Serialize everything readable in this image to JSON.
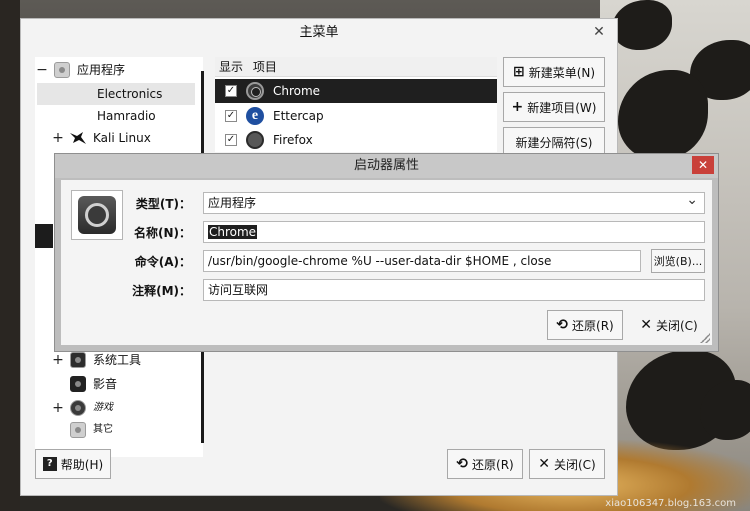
{
  "main_window": {
    "title": "主菜单",
    "close_label": "✕",
    "tree": [
      {
        "label": "应用程序",
        "expander": "−",
        "icon": "gear-icon"
      },
      {
        "label": "Electronics"
      },
      {
        "label": "Hamradio"
      },
      {
        "label": "Kali Linux",
        "expander": "+",
        "icon": "kali-dragon-icon"
      }
    ],
    "tree_bottom": [
      {
        "label": "系统工具",
        "expander": "+",
        "icon": "system-tools-icon"
      },
      {
        "label": "影音",
        "icon": "multimedia-icon"
      },
      {
        "label": "游戏",
        "expander": "+",
        "icon": "games-icon"
      },
      {
        "label": "其它",
        "icon": "gear-icon"
      }
    ],
    "list_headers": {
      "show": "显示",
      "item": "项目"
    },
    "items": [
      {
        "label": "Chrome",
        "checked": "✓",
        "icon": "chrome-icon"
      },
      {
        "label": "Ettercap",
        "checked": "✓",
        "icon": "ettercap-icon"
      },
      {
        "label": "Firefox",
        "checked": "✓",
        "icon": "firefox-icon"
      }
    ],
    "buttons": {
      "new_menu": "新建菜单(N)",
      "new_item": "新建项目(W)",
      "new_separator": "新建分隔符(S)",
      "help": "帮助(H)",
      "revert": "还原(R)",
      "close": "关闭(C)"
    }
  },
  "dialog": {
    "title": "启动器属性",
    "close_label": "✕",
    "type_label": "类型(T)：",
    "type_value": "应用程序",
    "name_label": "名称(N)：",
    "name_value": "Chrome",
    "command_label": "命令(A)：",
    "command_value": "/usr/bin/google-chrome %U --user-data-dir $HOME , close",
    "browse_button": "浏览(B)...",
    "comment_label": "注释(M)：",
    "comment_value": "访问互联网",
    "revert_button": "还原(R)",
    "close_button": "关闭(C)"
  },
  "watermark": "xiao106347.blog.163.com",
  "colors": {
    "close_red": "#c9403a",
    "selection": "#1f1f1f"
  }
}
